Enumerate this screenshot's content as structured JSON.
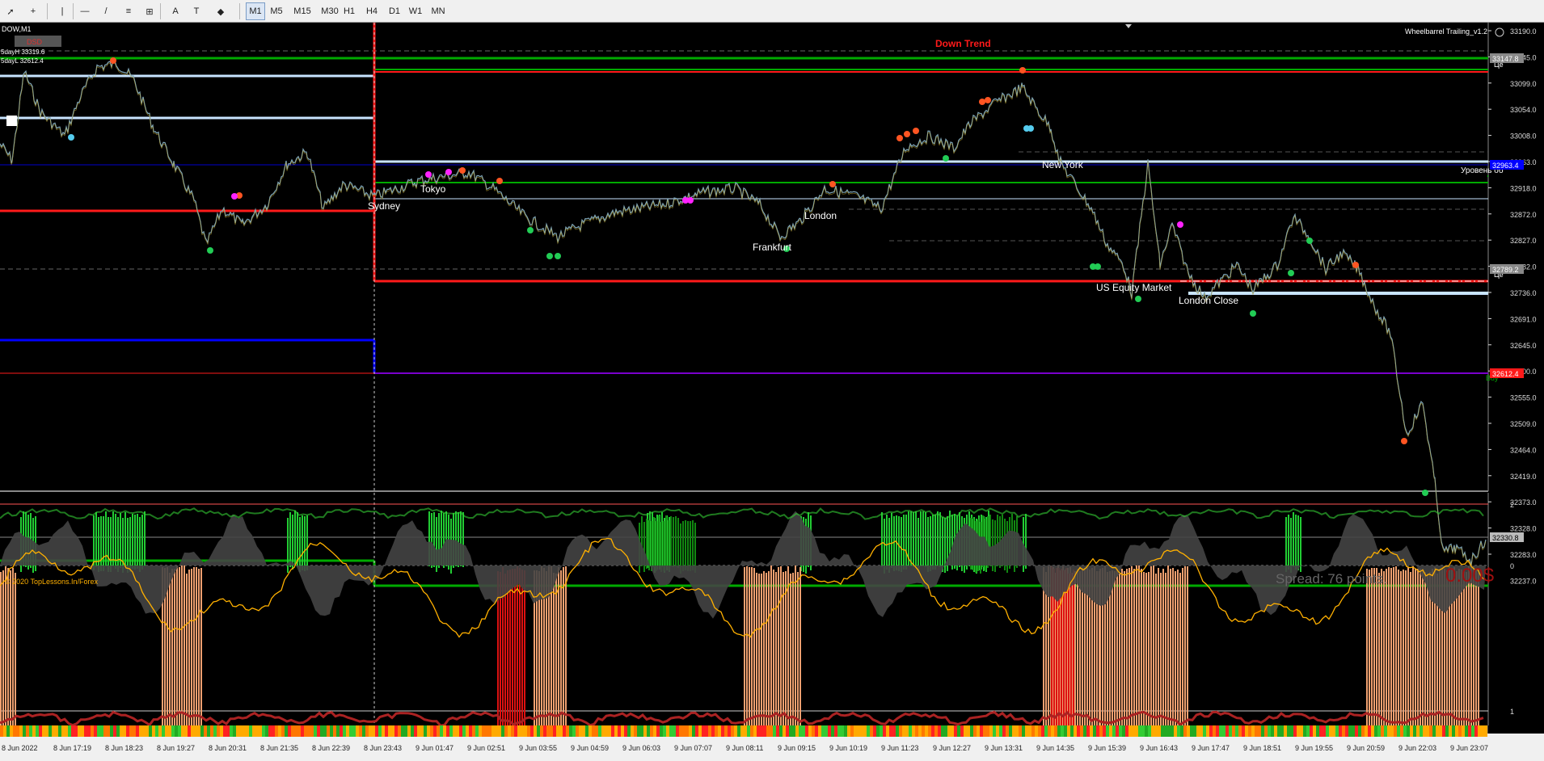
{
  "toolbar": {
    "timeframes": [
      {
        "label": "M1",
        "active": true
      },
      {
        "label": "M5",
        "active": false
      },
      {
        "label": "M15",
        "active": false
      },
      {
        "label": "M30",
        "active": false
      },
      {
        "label": "H1",
        "active": false
      },
      {
        "label": "H4",
        "active": false
      },
      {
        "label": "D1",
        "active": false
      },
      {
        "label": "W1",
        "active": false
      },
      {
        "label": "MN",
        "active": false
      }
    ],
    "tools": [
      "cursor-icon",
      "crosshair-icon",
      "vertical-line-icon",
      "horizontal-line-icon",
      "trendline-icon",
      "fibonacci-icon",
      "channel-icon",
      "text-icon",
      "text-label-icon",
      "shapes-icon"
    ]
  },
  "chart": {
    "symbol": "DOW,M1",
    "badge": "DSD",
    "five_day_high": "5dayH 33319.6",
    "five_day_low": "5dayL 32612.4",
    "ea_name": "Wheelbarrel Trailing_v1.2",
    "trend_label": "Down Trend",
    "copyright": "© 2020 TopLessons.In/Forex",
    "spread": "Spread: 76 points.",
    "profit": "0.00$",
    "right_labels": {
      "level": "Уровень об",
      "buy": "Buy",
      "center1": "Це",
      "center2": "Це"
    },
    "price_tags": {
      "top": "33147.8",
      "blue": "32963.4",
      "mid": "32789.2",
      "red": "32612.4",
      "current": "32330.8"
    },
    "sessions": [
      "Sydney",
      "Tokyo",
      "Frankfurt",
      "London",
      "New York",
      "US Equity Market",
      "London Close"
    ],
    "price_axis": [
      "33190.0",
      "33145.0",
      "33099.0",
      "33054.0",
      "33008.0",
      "32963.0",
      "32918.0",
      "32872.0",
      "32827.0",
      "32782.0",
      "32736.0",
      "32691.0",
      "32645.0",
      "32600.0",
      "32555.0",
      "32509.0",
      "32464.0",
      "32419.0",
      "32373.0",
      "32328.0",
      "32283.0",
      "32237.0"
    ],
    "indicator_axis": [
      "2",
      "0",
      "1"
    ],
    "time_axis": [
      "8 Jun 2022",
      "8 Jun 17:19",
      "8 Jun 18:23",
      "8 Jun 19:27",
      "8 Jun 20:31",
      "8 Jun 21:35",
      "8 Jun 22:39",
      "8 Jun 23:43",
      "9 Jun 01:47",
      "9 Jun 02:51",
      "9 Jun 03:55",
      "9 Jun 04:59",
      "9 Jun 06:03",
      "9 Jun 07:07",
      "9 Jun 08:11",
      "9 Jun 09:15",
      "9 Jun 10:19",
      "9 Jun 11:23",
      "9 Jun 12:27",
      "9 Jun 13:31",
      "9 Jun 14:35",
      "9 Jun 15:39",
      "9 Jun 16:43",
      "9 Jun 17:47",
      "9 Jun 18:51",
      "9 Jun 19:55",
      "9 Jun 20:59",
      "9 Jun 22:03",
      "9 Jun 23:07"
    ]
  },
  "colors": {
    "green": "#00cc00",
    "red": "#ff1a1a",
    "blue": "#0000ff",
    "lightblue": "#c8e4ff",
    "price": "#8fb0c0",
    "gold": "#ffb000"
  }
}
